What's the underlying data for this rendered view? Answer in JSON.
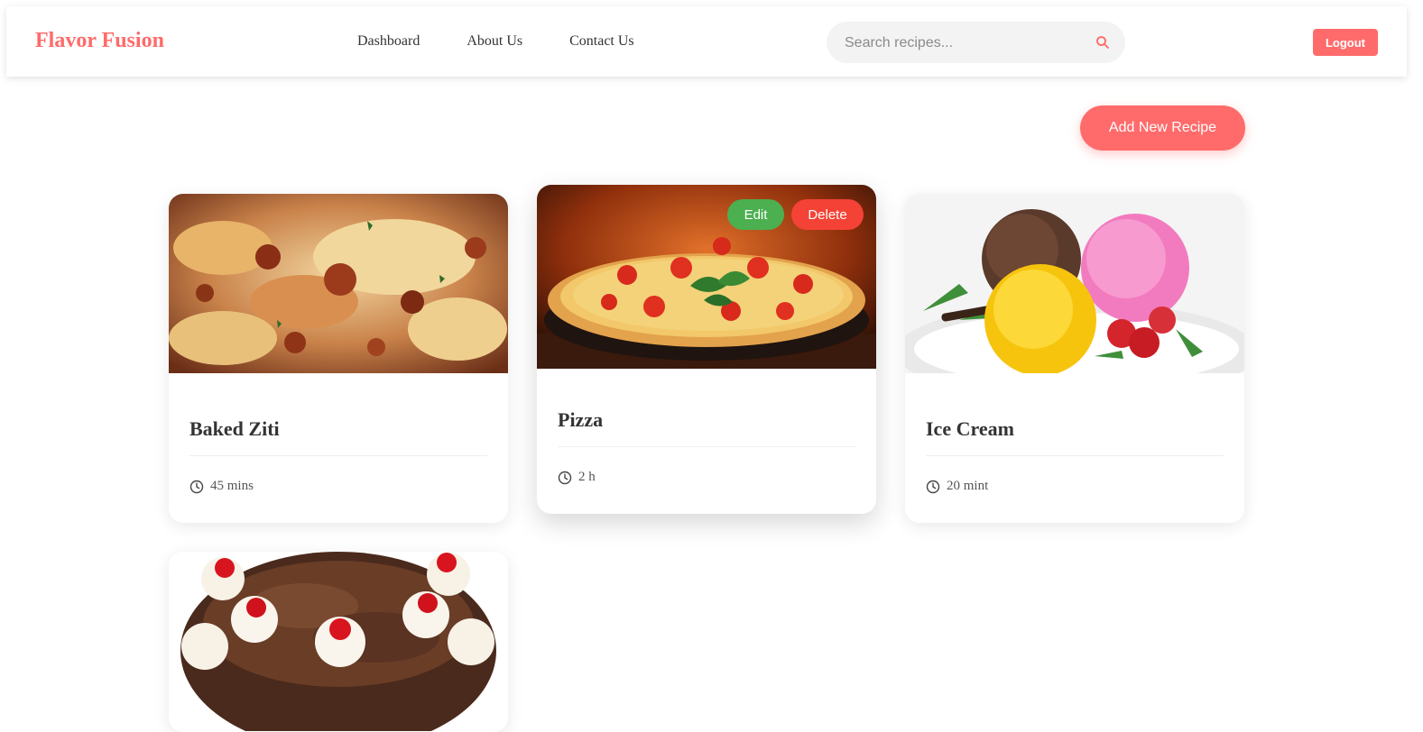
{
  "navbar": {
    "brand": "Flavor Fusion",
    "links": [
      {
        "label": "Dashboard"
      },
      {
        "label": "About Us"
      },
      {
        "label": "Contact Us"
      }
    ],
    "search": {
      "placeholder": "Search recipes...",
      "value": "",
      "icon": "search-icon"
    },
    "logout_label": "Logout"
  },
  "actions": {
    "add_recipe_label": "Add New Recipe"
  },
  "recipes": [
    {
      "title": "Baked Ziti",
      "time": "45 mins",
      "image": "baked-ziti"
    },
    {
      "title": "Pizza",
      "time": "2 h",
      "image": "pizza",
      "edit_label": "Edit",
      "delete_label": "Delete"
    },
    {
      "title": "Ice Cream",
      "time": "20 mint",
      "image": "ice-cream"
    },
    {
      "title": "",
      "time": "",
      "image": "black-forest-cake"
    }
  ],
  "colors": {
    "accent": "#ff6b6b",
    "edit": "#4caf50",
    "delete": "#f44336",
    "text": "#333333"
  }
}
